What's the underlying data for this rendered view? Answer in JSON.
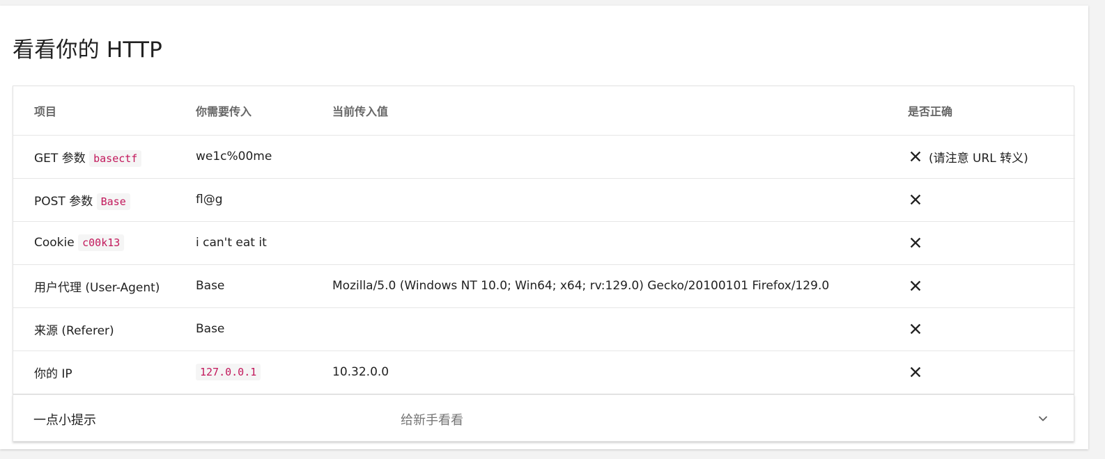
{
  "page": {
    "title": "看看你的 HTTP"
  },
  "table": {
    "headers": [
      "项目",
      "你需要传入",
      "当前传入值",
      "是否正确"
    ],
    "rows": [
      {
        "label": "GET 参数",
        "param": "basectf",
        "required": "we1c%00me",
        "required_is_code": false,
        "current": "",
        "status_icon": "close-icon",
        "note": "(请注意 URL 转义)"
      },
      {
        "label": "POST 参数",
        "param": "Base",
        "required": "fl@g",
        "required_is_code": false,
        "current": "",
        "status_icon": "close-icon",
        "note": ""
      },
      {
        "label": "Cookie",
        "param": "c00k13",
        "required": "i can't eat it",
        "required_is_code": false,
        "current": "",
        "status_icon": "close-icon",
        "note": ""
      },
      {
        "label": "用户代理 (User-Agent)",
        "param": "",
        "required": "Base",
        "required_is_code": false,
        "current": "Mozilla/5.0 (Windows NT 10.0; Win64; x64; rv:129.0) Gecko/20100101 Firefox/129.0",
        "status_icon": "close-icon",
        "note": ""
      },
      {
        "label": "来源 (Referer)",
        "param": "",
        "required": "Base",
        "required_is_code": false,
        "current": "",
        "status_icon": "close-icon",
        "note": ""
      },
      {
        "label": "你的 IP",
        "param": "",
        "required": "127.0.0.1",
        "required_is_code": true,
        "current": "10.32.0.0",
        "status_icon": "close-icon",
        "note": ""
      }
    ]
  },
  "hint": {
    "title": "一点小提示",
    "subtitle": "给新手看看",
    "icon": "chevron-down-icon"
  },
  "colors": {
    "code_text": "#c2185b",
    "code_bg": "#f5f5f5",
    "header_text": "#666666"
  }
}
